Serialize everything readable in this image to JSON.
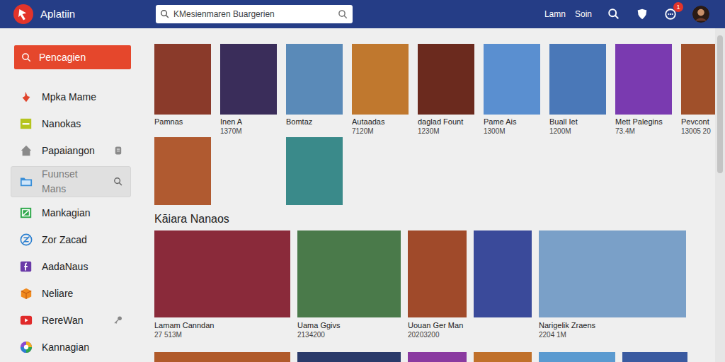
{
  "app": {
    "title": "Aplatiin"
  },
  "search": {
    "value": "KMesienmaren Buargerien"
  },
  "header": {
    "links": [
      "Lamn",
      "Soin"
    ],
    "notification_badge": "1"
  },
  "sidebar": {
    "button": "Pencagien",
    "items": [
      {
        "label": "Mpka Mame",
        "selected": false,
        "color": "#e0442c",
        "kind": "plain"
      },
      {
        "label": "Nanokas",
        "selected": false,
        "color": "#b5c41e",
        "kind": "plain"
      },
      {
        "label": "Papaiangon",
        "selected": false,
        "color": "#8a8a8a",
        "kind": "badge"
      },
      {
        "label": "Fuunset Mans",
        "selected": true,
        "color": "#3a8fd8",
        "kind": "search"
      },
      {
        "label": "Mankagian",
        "selected": false,
        "color": "#2ea84a",
        "kind": "plain"
      },
      {
        "label": "Zor Zacad",
        "selected": false,
        "color": "#2a7fd0",
        "kind": "plain"
      },
      {
        "label": "AadaNaus",
        "selected": false,
        "color": "#6a3aa8",
        "kind": "plain"
      },
      {
        "label": "Neliare",
        "selected": false,
        "color": "#f08a1e",
        "kind": "plain"
      },
      {
        "label": "RereWan",
        "selected": false,
        "color": "#e02a2a",
        "kind": "key"
      },
      {
        "label": "Kannagian",
        "selected": false,
        "color": "#8a4ad0",
        "kind": "plain"
      }
    ]
  },
  "games": [
    {
      "title": "Pamnas"
    },
    {
      "title": "Inen A",
      "count": "1370M"
    },
    {
      "title": "Bomtaz"
    },
    {
      "title": "Autaadas",
      "count": "7120M"
    },
    {
      "title": "daglad Fount",
      "count": "1230M"
    },
    {
      "title": "Pame Ais",
      "count": "1300M"
    },
    {
      "title": "Buall Iet",
      "count": "1200M"
    },
    {
      "title": "Mett Palegins",
      "count": "73.4M"
    },
    {
      "title": "Pevcont",
      "count": "13005 20"
    }
  ],
  "section": {
    "title": "Kāiara Nanaos"
  },
  "featured": [
    {
      "title": "Lamam Canndan",
      "count": "27 513M"
    },
    {
      "title": "Uama Ggivs",
      "count": "2134200"
    },
    {
      "title": "Uouan Ger Man",
      "count": "20203200"
    },
    {},
    {
      "title": "Narigelik Zraens",
      "count": "2204 1M"
    }
  ]
}
